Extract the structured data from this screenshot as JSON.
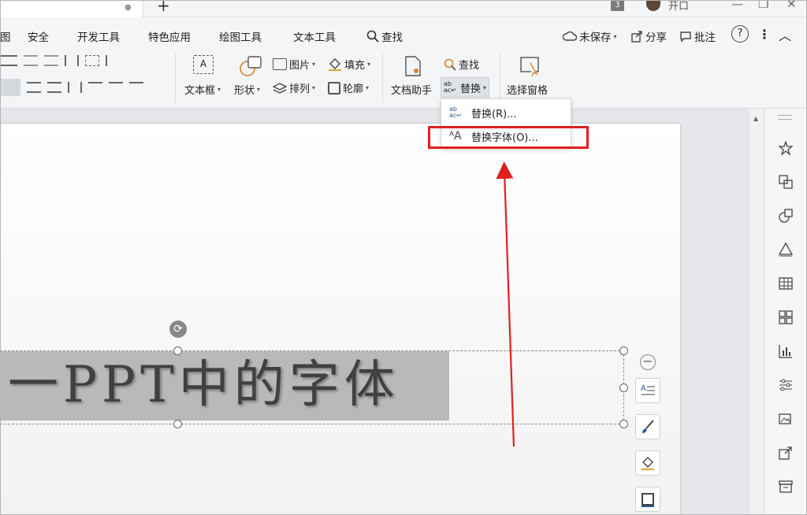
{
  "titlebar": {
    "badge": "3",
    "user": "开口"
  },
  "menu": {
    "items": [
      "安全",
      "开发工具",
      "特色应用",
      "绘图工具",
      "文本工具"
    ],
    "search": "查找",
    "unsaved": "未保存",
    "share": "分享",
    "comment": "批注",
    "help": "?",
    "more": "⋮",
    "collapse": "︿",
    "partial_left": "图"
  },
  "ribbon": {
    "textbox": "文本框",
    "shape": "形状",
    "picture": "图片",
    "fill": "填充",
    "arrange": "排列",
    "outline": "轮廓",
    "doc_assistant": "文档助手",
    "find": "查找",
    "replace": "替换",
    "selection_pane": "选择窗格"
  },
  "dropdown": {
    "items": [
      {
        "label": "替换(R)...",
        "icon": "replace-icon"
      },
      {
        "label": "替换字体(O)...",
        "icon": "replace-font-icon"
      }
    ]
  },
  "slide": {
    "title": "一PPT中的字体"
  },
  "colors": {
    "highlight": "#e02020",
    "accent": "#2b579a"
  }
}
